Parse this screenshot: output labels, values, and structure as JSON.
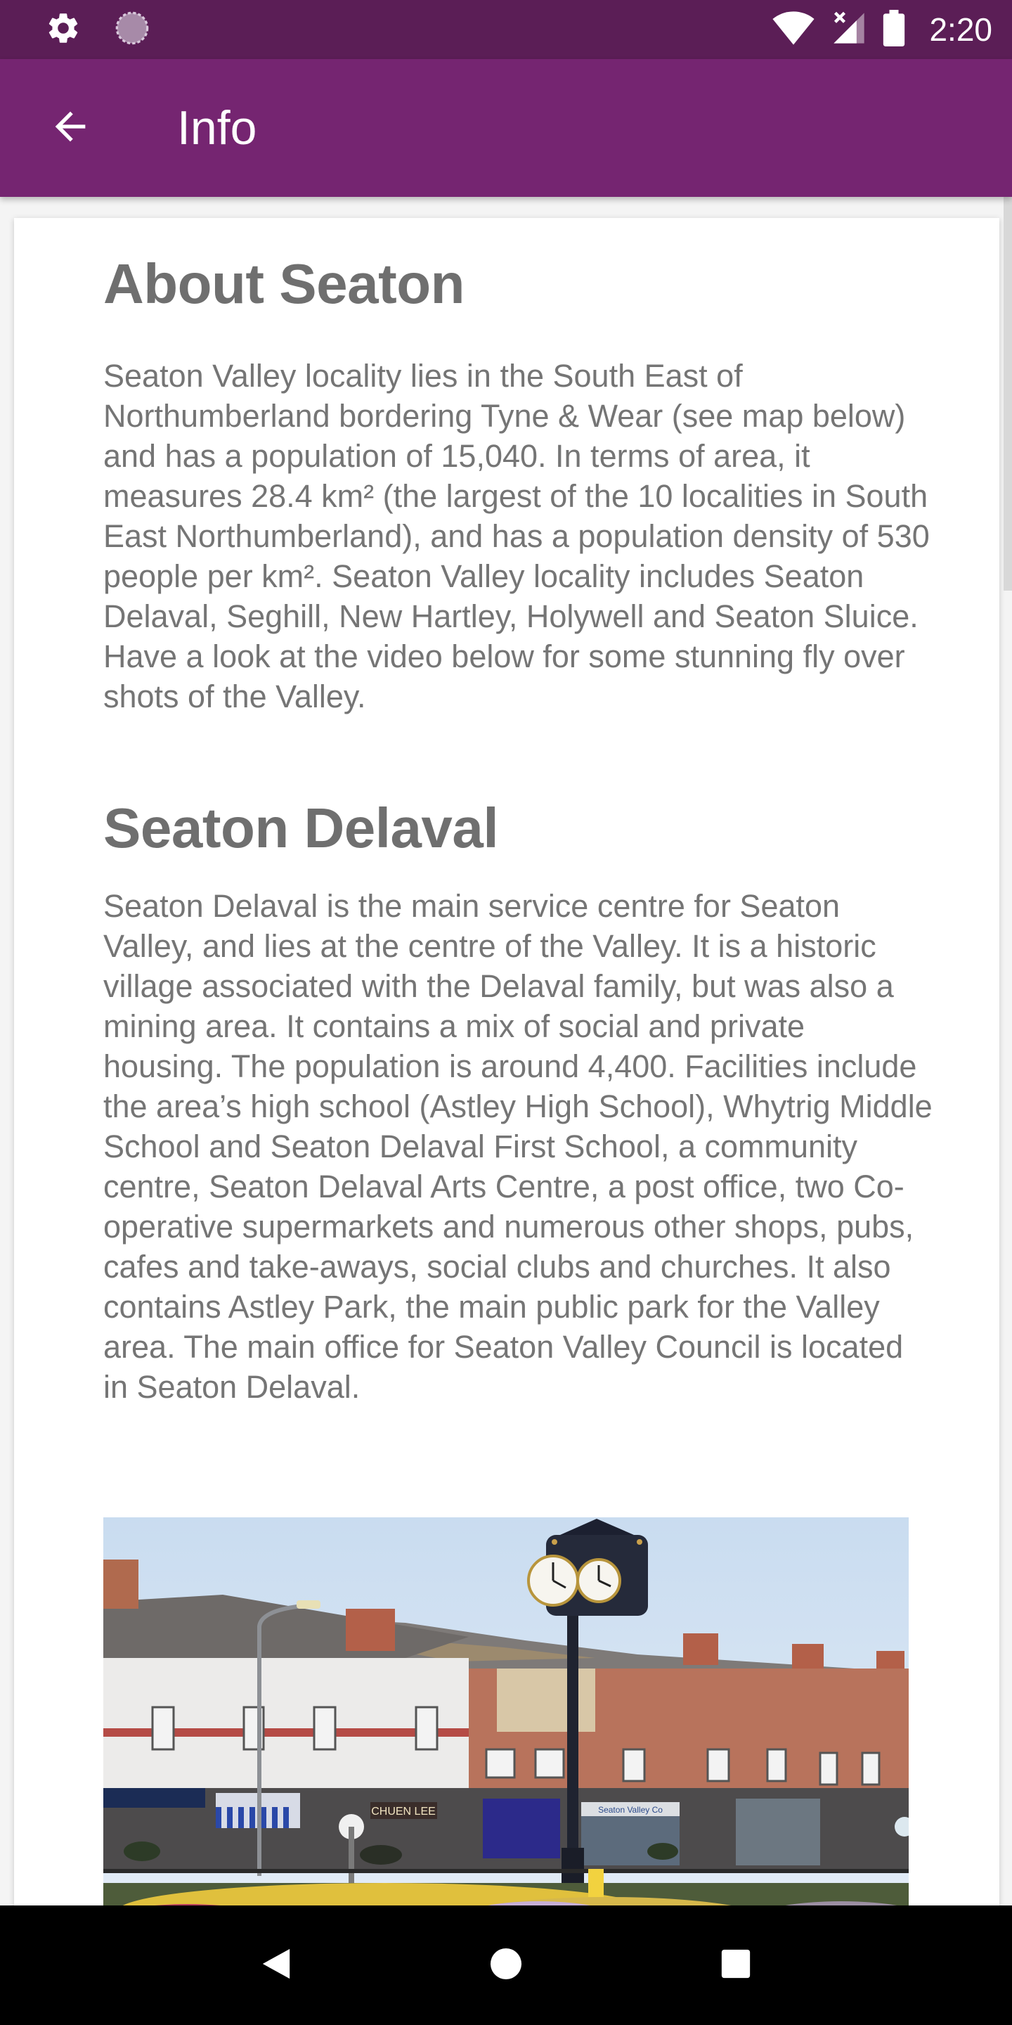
{
  "status_bar": {
    "time": "2:20",
    "left_icons": [
      "gear-icon",
      "spinner-icon"
    ],
    "right_icons": [
      "wifi-icon",
      "signal-icon",
      "battery-icon"
    ]
  },
  "app_bar": {
    "title": "Info",
    "back_icon": "arrow-left-icon",
    "color": "#752571",
    "status_color": "#5b1e56"
  },
  "sections": [
    {
      "title": "About Seaton",
      "body": "Seaton Valley locality lies in the South East of Northumberland bordering Tyne & Wear (see map below) and has a population of 15,040. In terms of area, it measures 28.4 km² (the largest of the 10 localities in South East Northumberland), and has a population density of 530 people per km². Seaton Valley locality includes Seaton Delaval, Seghill, New Hartley, Holywell and Seaton Sluice. Have a look at the video below for some stunning fly over shots of the Valley."
    },
    {
      "title": "Seaton Delaval",
      "body": "Seaton Delaval is the main service centre for Seaton Valley, and lies at the centre of the Valley. It is a historic village associated with the Delaval family, but was also a mining area. It contains a mix of social and private housing. The population is around 4,400. Facilities include the area’s high school (Astley High School), Whytrig Middle School and Seaton Delaval First School, a community centre, Seaton Delaval Arts Centre, a post office, two Co-operative supermarkets and numerous other shops, pubs, cafes and take-aways, social clubs and churches. It also contains Astley Park, the main public park for the Valley area. The main office for Seaton Valley Council is located in Seaton Delaval."
    }
  ],
  "photo": {
    "shop_signs": [
      "CHUEN LEE",
      "Seaton Valley Co"
    ]
  },
  "nav_bar": {
    "icons": [
      "back-triangle-icon",
      "home-circle-icon",
      "recents-square-icon"
    ]
  }
}
